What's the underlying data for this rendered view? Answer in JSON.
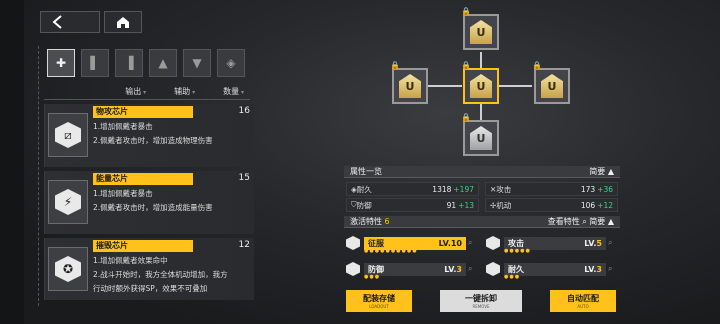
{
  "nav": {
    "back_icon": "back-arrow-icon",
    "home_icon": "home-icon"
  },
  "tabs": [
    {
      "icon": "all-chips-icon"
    },
    {
      "icon": "chip-type-1-icon"
    },
    {
      "icon": "chip-type-2-icon"
    },
    {
      "icon": "chip-type-3-icon"
    },
    {
      "icon": "chip-type-4-icon"
    },
    {
      "icon": "chip-type-5-icon"
    }
  ],
  "sort": {
    "output": "输出",
    "support": "辅助",
    "quantity": "数量"
  },
  "chips": [
    {
      "name": "物攻芯片",
      "count": "16",
      "d1": "1.增加佩戴者暴击",
      "d2": "2.佩戴者攻击时，增加造成物理伤害",
      "d3": ""
    },
    {
      "name": "能量芯片",
      "count": "15",
      "d1": "1.增加佩戴者暴击",
      "d2": "2.佩戴者攻击时，增加造成能量伤害",
      "d3": ""
    },
    {
      "name": "摧毁芯片",
      "count": "12",
      "d1": "1.增加佩戴者效果命中",
      "d2": "2.战斗开始时，我方全体机动增加，我方",
      "d3": "行动时额外获得SP，效果不可叠加"
    }
  ],
  "attributes": {
    "title": "属性一览",
    "brief": "简要",
    "items": [
      {
        "label": "耐久",
        "value": "1318",
        "plus": "+197"
      },
      {
        "label": "攻击",
        "value": "173",
        "plus": "+36"
      },
      {
        "label": "防御",
        "value": "91",
        "plus": "+13"
      },
      {
        "label": "机动",
        "value": "106",
        "plus": "+12"
      }
    ]
  },
  "traits": {
    "title": "激活特性",
    "count": "6",
    "view": "查看特性",
    "brief": "简要",
    "items": [
      {
        "name": "征服",
        "lv_prefix": "LV.",
        "lv": "10",
        "highlight": true
      },
      {
        "name": "攻击",
        "lv_prefix": "LV.",
        "lv": "5",
        "highlight": false
      },
      {
        "name": "防御",
        "lv_prefix": "LV.",
        "lv": "3",
        "highlight": false
      },
      {
        "name": "耐久",
        "lv_prefix": "LV.",
        "lv": "3",
        "highlight": false
      }
    ]
  },
  "buttons": {
    "save": "配装存储",
    "save_sub": "LOADOUT",
    "remove": "一键拆卸",
    "remove_sub": "REMOVE",
    "auto": "自动匹配",
    "auto_sub": "AUTO"
  },
  "colors": {
    "accent": "#ffc11a",
    "plus": "#39d48a"
  }
}
